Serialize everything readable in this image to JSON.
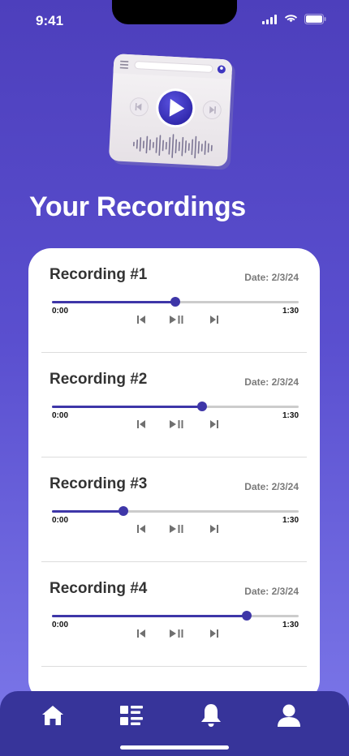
{
  "status": {
    "time": "9:41"
  },
  "page": {
    "title": "Your Recordings"
  },
  "recordings": [
    {
      "title": "Recording #1",
      "date": "Date: 2/3/24",
      "current": "0:00",
      "duration": "1:30",
      "progress": 0.5
    },
    {
      "title": "Recording #2",
      "date": "Date: 2/3/24",
      "current": "0:00",
      "duration": "1:30",
      "progress": 0.61
    },
    {
      "title": "Recording #3",
      "date": "Date: 2/3/24",
      "current": "0:00",
      "duration": "1:30",
      "progress": 0.29
    },
    {
      "title": "Recording #4",
      "date": "Date: 2/3/24",
      "current": "0:00",
      "duration": "1:30",
      "progress": 0.79
    }
  ],
  "nav": {
    "items": [
      "home-icon",
      "list-icon",
      "bell-icon",
      "profile-icon"
    ]
  },
  "colors": {
    "accent": "#3e36a8",
    "nav_bg": "#37349a",
    "track": "#cccccc",
    "gradient_top": "#4d3fbc",
    "gradient_bottom": "#7d79ea"
  }
}
